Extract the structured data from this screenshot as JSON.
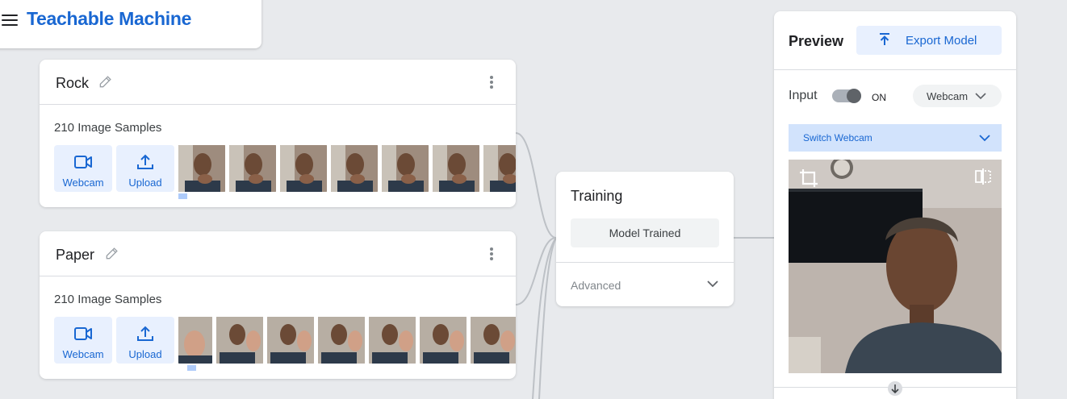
{
  "header": {
    "title": "Teachable Machine",
    "menu_icon": "menu-icon"
  },
  "classes": [
    {
      "name": "Rock",
      "samples": "210 Image Samples",
      "webcam_label": "Webcam",
      "upload_label": "Upload"
    },
    {
      "name": "Paper",
      "samples": "210 Image Samples",
      "webcam_label": "Webcam",
      "upload_label": "Upload"
    }
  ],
  "training": {
    "title": "Training",
    "button": "Model Trained",
    "advanced": "Advanced"
  },
  "preview": {
    "title": "Preview",
    "export_label": "Export Model",
    "input_label": "Input",
    "input_state": "ON",
    "source": "Webcam",
    "switch_label": "Switch Webcam"
  },
  "colors": {
    "accent": "#1967d2",
    "button_bg": "#e8f0fe",
    "background": "#e8eaed"
  }
}
